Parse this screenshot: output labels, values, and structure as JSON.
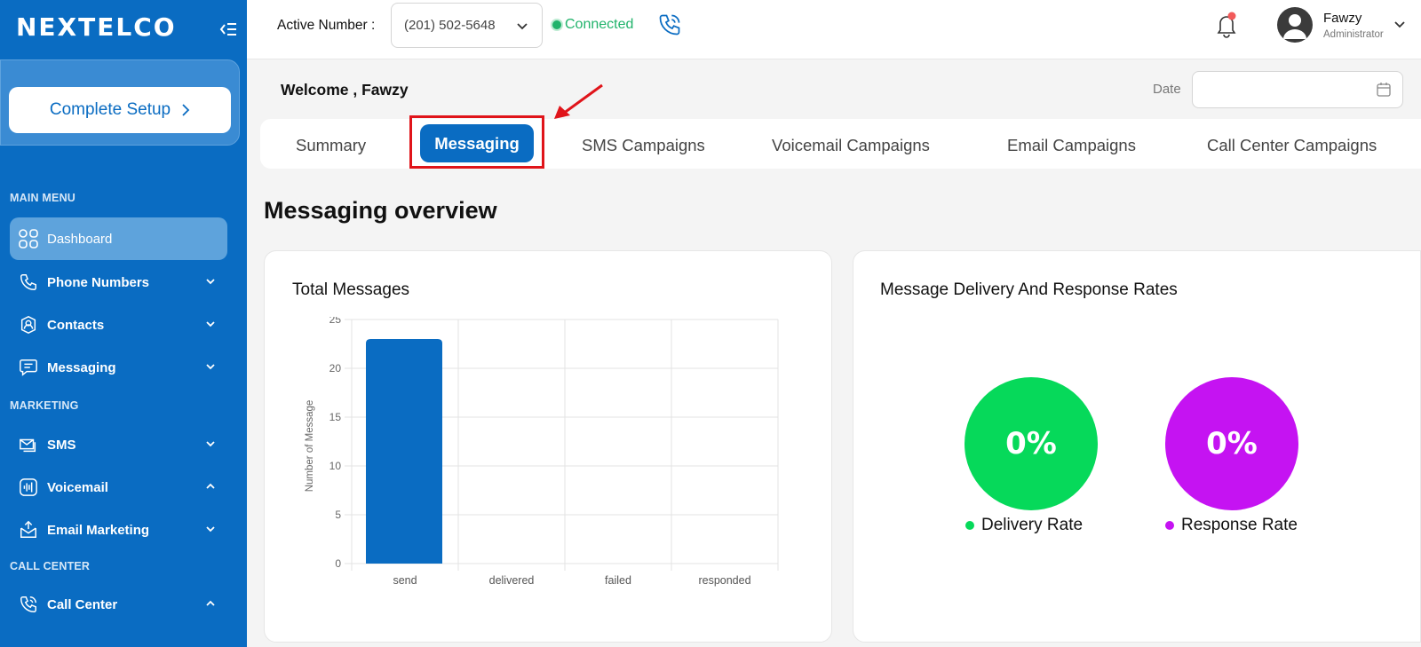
{
  "app": {
    "logo_text": "NEXTELCO"
  },
  "sidebar": {
    "setup_label": "Complete Setup",
    "sections": {
      "main": "MAIN MENU",
      "marketing": "MARKETING",
      "call_center": "CALL CENTER"
    },
    "items": [
      {
        "label": "Dashboard",
        "icon": "dashboard-grid-icon",
        "active": true
      },
      {
        "label": "Phone Numbers",
        "icon": "phone-icon",
        "chevron": "down"
      },
      {
        "label": "Contacts",
        "icon": "contact-icon",
        "chevron": "down"
      },
      {
        "label": "Messaging",
        "icon": "message-icon",
        "chevron": "down"
      },
      {
        "label": "SMS",
        "icon": "sms-icon",
        "chevron": "down"
      },
      {
        "label": "Voicemail",
        "icon": "voicemail-icon",
        "chevron": "up"
      },
      {
        "label": "Email Marketing",
        "icon": "email-marketing-icon",
        "chevron": "down"
      },
      {
        "label": "Call Center",
        "icon": "call-center-icon",
        "chevron": "up"
      }
    ]
  },
  "header": {
    "active_number_label": "Active Number :",
    "active_number_value": "(201) 502-5648",
    "status": "Connected",
    "user_name": "Fawzy",
    "user_role": "Administrator"
  },
  "welcome": "Welcome , Fawzy",
  "date_label": "Date",
  "date_value": "",
  "tabs": [
    {
      "label": "Summary"
    },
    {
      "label": "Messaging",
      "active": true
    },
    {
      "label": "SMS Campaigns"
    },
    {
      "label": "Voicemail Campaigns"
    },
    {
      "label": "Email Campaigns"
    },
    {
      "label": "Call Center Campaigns"
    }
  ],
  "overview_title": "Messaging overview",
  "total_messages_title": "Total Messages",
  "rates_title": "Message Delivery And Response Rates",
  "rates": [
    {
      "value": "0%",
      "label": "Delivery Rate",
      "color": "#06d95a"
    },
    {
      "value": "0%",
      "label": "Response Rate",
      "color": "#c513f2"
    }
  ],
  "colors": {
    "brand": "#0a6cc2",
    "connected": "#21b36b",
    "highlight": "#e0141a"
  },
  "chart_data": {
    "type": "bar",
    "categories": [
      "send",
      "delivered",
      "failed",
      "responded"
    ],
    "values": [
      23,
      0,
      0,
      0
    ],
    "title": "Total Messages",
    "xlabel": "",
    "ylabel": "Number of Message",
    "ylim": [
      0,
      25
    ],
    "yticks": [
      0,
      5,
      10,
      15,
      20,
      25
    ],
    "grid": true,
    "bar_color": "#0a6cc2"
  }
}
